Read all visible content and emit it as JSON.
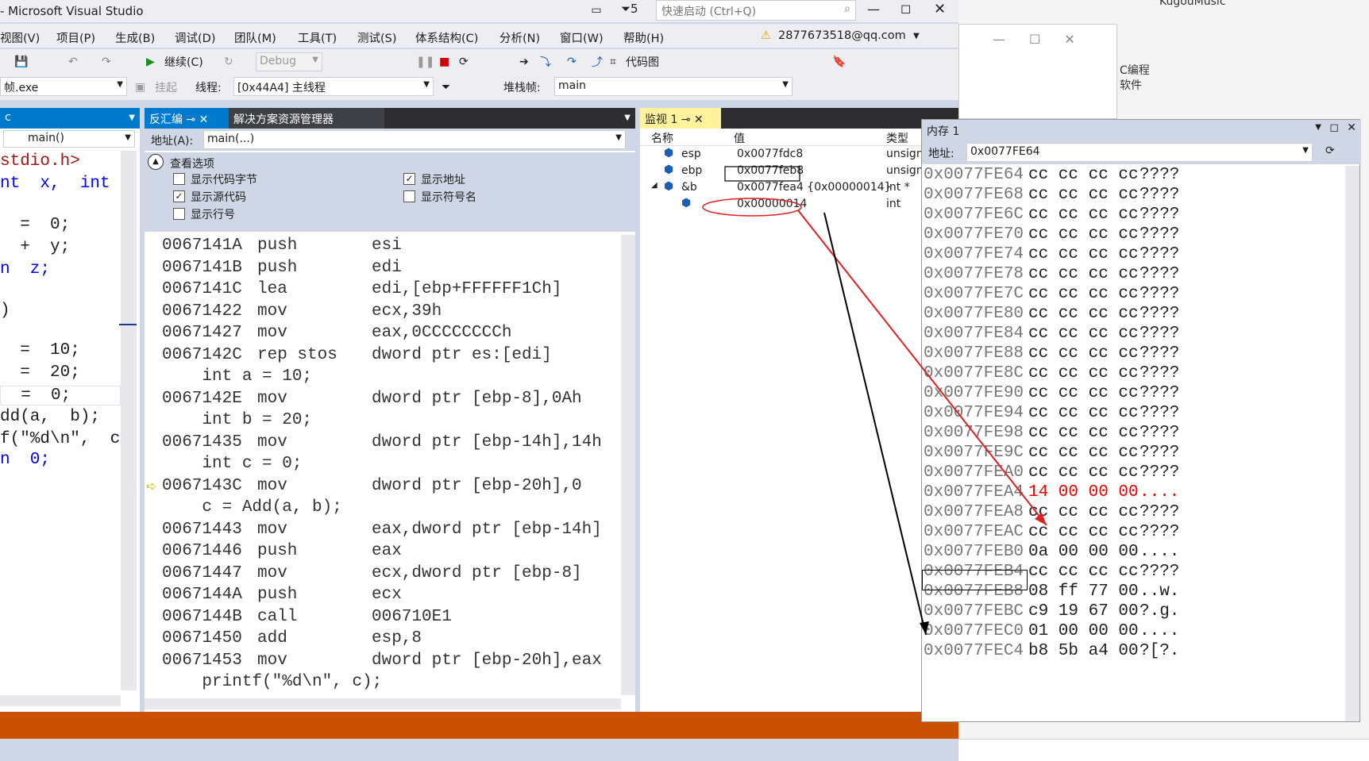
{
  "window": {
    "title": "- Microsoft Visual Studio",
    "quick_launch": "快速启动 (Ctrl+Q)",
    "notif_count": "5",
    "user": "2877673518@qq.com"
  },
  "menu": [
    "视图(V)",
    "项目(P)",
    "生成(B)",
    "调试(D)",
    "团队(M)",
    "工具(T)",
    "测试(S)",
    "体系结构(C)",
    "分析(N)",
    "窗口(W)",
    "帮助(H)"
  ],
  "toolbar": {
    "continue": "继续(C)",
    "config": "Debug",
    "code_map": "代码图"
  },
  "toolbar2": {
    "process": "帧.exe",
    "suspend": "挂起",
    "thread_label": "线程:",
    "thread": "[0x44A4] 主线程",
    "stack_label": "堆栈帧:",
    "stack": "main"
  },
  "editor": {
    "tab": "c",
    "func": "main()",
    "lines": [
      "stdio.h>",
      "nt  x,  int  y)",
      "",
      "  =  0;",
      "  +  y;",
      "n  z;",
      "",
      "",
      ")",
      "",
      "  =  10;",
      "  =  20;",
      "  =  0;",
      "dd(a,  b);",
      "f(\"%d\\n\",  c)",
      "n  0;"
    ]
  },
  "disasm": {
    "tab": "反汇编",
    "tab2": "解决方案资源管理器",
    "addr_label": "地址(A):",
    "addr": "main(...)",
    "options_title": "查看选项",
    "opts": [
      {
        "label": "显示代码字节",
        "checked": false
      },
      {
        "label": "显示地址",
        "checked": true
      },
      {
        "label": "显示源代码",
        "checked": true
      },
      {
        "label": "显示符号名",
        "checked": false
      },
      {
        "label": "显示行号",
        "checked": false
      }
    ],
    "lines": [
      {
        "a": "0067141A",
        "op": "push",
        "arg": "esi"
      },
      {
        "a": "0067141B",
        "op": "push",
        "arg": "edi"
      },
      {
        "a": "0067141C",
        "op": "lea",
        "arg": "edi,[ebp+FFFFFF1Ch]"
      },
      {
        "a": "00671422",
        "op": "mov",
        "arg": "ecx,39h"
      },
      {
        "a": "00671427",
        "op": "mov",
        "arg": "eax,0CCCCCCCCh"
      },
      {
        "a": "0067142C",
        "op": "rep stos",
        "arg": "dword ptr es:[edi]"
      },
      {
        "src": "    int a = 10;"
      },
      {
        "a": "0067142E",
        "op": "mov",
        "arg": "dword ptr [ebp-8],0Ah"
      },
      {
        "src": "    int b = 20;"
      },
      {
        "a": "00671435",
        "op": "mov",
        "arg": "dword ptr [ebp-14h],14h"
      },
      {
        "src": "    int c = 0;"
      },
      {
        "a": "0067143C",
        "op": "mov",
        "arg": "dword ptr [ebp-20h],0"
      },
      {
        "src": "    c = Add(a, b);"
      },
      {
        "a": "00671443",
        "op": "mov",
        "arg": "eax,dword ptr [ebp-14h]"
      },
      {
        "a": "00671446",
        "op": "push",
        "arg": "eax"
      },
      {
        "a": "00671447",
        "op": "mov",
        "arg": "ecx,dword ptr [ebp-8]"
      },
      {
        "a": "0067144A",
        "op": "push",
        "arg": "ecx"
      },
      {
        "a": "0067144B",
        "op": "call",
        "arg": "006710E1"
      },
      {
        "a": "00671450",
        "op": "add",
        "arg": "esp,8"
      },
      {
        "a": "00671453",
        "op": "mov",
        "arg": "dword ptr [ebp-20h],eax"
      },
      {
        "src": "    printf(\"%d\\n\", c);"
      }
    ]
  },
  "watch": {
    "tab": "监视 1",
    "cols": [
      "名称",
      "值",
      "类型"
    ],
    "rows": [
      {
        "name": "esp",
        "value": "0x0077fdc8",
        "type": "unsign"
      },
      {
        "name": "ebp",
        "value": "0x0077feb8",
        "type": "unsign"
      },
      {
        "name": "&b",
        "value": "0x0077fea4 {0x00000014}",
        "type": "int *"
      },
      {
        "name": "",
        "value": "0x00000014",
        "type": "int"
      }
    ]
  },
  "memory": {
    "title": "内存 1",
    "addr_label": "地址:",
    "addr": "0x0077FE64",
    "rows": [
      [
        "0x0077FE64",
        "cc cc cc cc",
        "????"
      ],
      [
        "0x0077FE68",
        "cc cc cc cc",
        "????"
      ],
      [
        "0x0077FE6C",
        "cc cc cc cc",
        "????"
      ],
      [
        "0x0077FE70",
        "cc cc cc cc",
        "????"
      ],
      [
        "0x0077FE74",
        "cc cc cc cc",
        "????"
      ],
      [
        "0x0077FE78",
        "cc cc cc cc",
        "????"
      ],
      [
        "0x0077FE7C",
        "cc cc cc cc",
        "????"
      ],
      [
        "0x0077FE80",
        "cc cc cc cc",
        "????"
      ],
      [
        "0x0077FE84",
        "cc cc cc cc",
        "????"
      ],
      [
        "0x0077FE88",
        "cc cc cc cc",
        "????"
      ],
      [
        "0x0077FE8C",
        "cc cc cc cc",
        "????"
      ],
      [
        "0x0077FE90",
        "cc cc cc cc",
        "????"
      ],
      [
        "0x0077FE94",
        "cc cc cc cc",
        "????"
      ],
      [
        "0x0077FE98",
        "cc cc cc cc",
        "????"
      ],
      [
        "0x0077FE9C",
        "cc cc cc cc",
        "????"
      ],
      [
        "0x0077FEA0",
        "cc cc cc cc",
        "????"
      ],
      [
        "0x0077FEA4",
        "14 00 00 00",
        "...."
      ],
      [
        "0x0077FEA8",
        "cc cc cc cc",
        "????"
      ],
      [
        "0x0077FEAC",
        "cc cc cc cc",
        "????"
      ],
      [
        "0x0077FEB0",
        "0a 00 00 00",
        "...."
      ],
      [
        "0x0077FEB4",
        "cc cc cc cc",
        "????"
      ],
      [
        "0x0077FEB8",
        "08 ff 77 00",
        "..w."
      ],
      [
        "0x0077FEBC",
        "c9 19 67 00",
        "?.g."
      ],
      [
        "0x0077FEC0",
        "01 00 00 00",
        "...."
      ],
      [
        "0x0077FEC4",
        "b8 5b a4 00",
        "?[?."
      ]
    ]
  },
  "desktop": {
    "label1": "KugouMusic",
    "label2": "C编程",
    "label3": "软件"
  },
  "colors": {
    "accent": "#007acc",
    "status": "#ca5100",
    "highlight": "#ff0000"
  }
}
